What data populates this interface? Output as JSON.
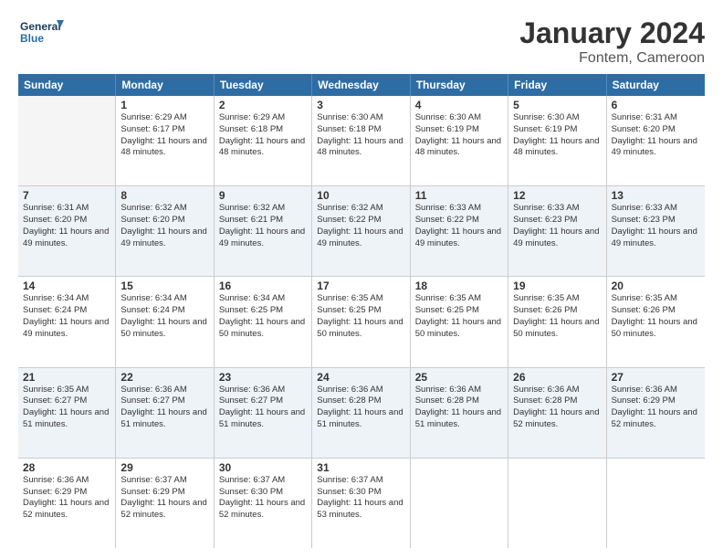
{
  "header": {
    "logo_line1": "General",
    "logo_line2": "Blue",
    "main_title": "January 2024",
    "subtitle": "Fontem, Cameroon"
  },
  "days_of_week": [
    "Sunday",
    "Monday",
    "Tuesday",
    "Wednesday",
    "Thursday",
    "Friday",
    "Saturday"
  ],
  "rows": [
    [
      {
        "day": "",
        "sunrise": "",
        "sunset": "",
        "daylight": "",
        "empty": true
      },
      {
        "day": "1",
        "sunrise": "Sunrise: 6:29 AM",
        "sunset": "Sunset: 6:17 PM",
        "daylight": "Daylight: 11 hours and 48 minutes."
      },
      {
        "day": "2",
        "sunrise": "Sunrise: 6:29 AM",
        "sunset": "Sunset: 6:18 PM",
        "daylight": "Daylight: 11 hours and 48 minutes."
      },
      {
        "day": "3",
        "sunrise": "Sunrise: 6:30 AM",
        "sunset": "Sunset: 6:18 PM",
        "daylight": "Daylight: 11 hours and 48 minutes."
      },
      {
        "day": "4",
        "sunrise": "Sunrise: 6:30 AM",
        "sunset": "Sunset: 6:19 PM",
        "daylight": "Daylight: 11 hours and 48 minutes."
      },
      {
        "day": "5",
        "sunrise": "Sunrise: 6:30 AM",
        "sunset": "Sunset: 6:19 PM",
        "daylight": "Daylight: 11 hours and 48 minutes."
      },
      {
        "day": "6",
        "sunrise": "Sunrise: 6:31 AM",
        "sunset": "Sunset: 6:20 PM",
        "daylight": "Daylight: 11 hours and 49 minutes."
      }
    ],
    [
      {
        "day": "7",
        "sunrise": "Sunrise: 6:31 AM",
        "sunset": "Sunset: 6:20 PM",
        "daylight": "Daylight: 11 hours and 49 minutes."
      },
      {
        "day": "8",
        "sunrise": "Sunrise: 6:32 AM",
        "sunset": "Sunset: 6:20 PM",
        "daylight": "Daylight: 11 hours and 49 minutes."
      },
      {
        "day": "9",
        "sunrise": "Sunrise: 6:32 AM",
        "sunset": "Sunset: 6:21 PM",
        "daylight": "Daylight: 11 hours and 49 minutes."
      },
      {
        "day": "10",
        "sunrise": "Sunrise: 6:32 AM",
        "sunset": "Sunset: 6:22 PM",
        "daylight": "Daylight: 11 hours and 49 minutes."
      },
      {
        "day": "11",
        "sunrise": "Sunrise: 6:33 AM",
        "sunset": "Sunset: 6:22 PM",
        "daylight": "Daylight: 11 hours and 49 minutes."
      },
      {
        "day": "12",
        "sunrise": "Sunrise: 6:33 AM",
        "sunset": "Sunset: 6:23 PM",
        "daylight": "Daylight: 11 hours and 49 minutes."
      },
      {
        "day": "13",
        "sunrise": "Sunrise: 6:33 AM",
        "sunset": "Sunset: 6:23 PM",
        "daylight": "Daylight: 11 hours and 49 minutes."
      }
    ],
    [
      {
        "day": "14",
        "sunrise": "Sunrise: 6:34 AM",
        "sunset": "Sunset: 6:24 PM",
        "daylight": "Daylight: 11 hours and 49 minutes."
      },
      {
        "day": "15",
        "sunrise": "Sunrise: 6:34 AM",
        "sunset": "Sunset: 6:24 PM",
        "daylight": "Daylight: 11 hours and 50 minutes."
      },
      {
        "day": "16",
        "sunrise": "Sunrise: 6:34 AM",
        "sunset": "Sunset: 6:25 PM",
        "daylight": "Daylight: 11 hours and 50 minutes."
      },
      {
        "day": "17",
        "sunrise": "Sunrise: 6:35 AM",
        "sunset": "Sunset: 6:25 PM",
        "daylight": "Daylight: 11 hours and 50 minutes."
      },
      {
        "day": "18",
        "sunrise": "Sunrise: 6:35 AM",
        "sunset": "Sunset: 6:25 PM",
        "daylight": "Daylight: 11 hours and 50 minutes."
      },
      {
        "day": "19",
        "sunrise": "Sunrise: 6:35 AM",
        "sunset": "Sunset: 6:26 PM",
        "daylight": "Daylight: 11 hours and 50 minutes."
      },
      {
        "day": "20",
        "sunrise": "Sunrise: 6:35 AM",
        "sunset": "Sunset: 6:26 PM",
        "daylight": "Daylight: 11 hours and 50 minutes."
      }
    ],
    [
      {
        "day": "21",
        "sunrise": "Sunrise: 6:35 AM",
        "sunset": "Sunset: 6:27 PM",
        "daylight": "Daylight: 11 hours and 51 minutes."
      },
      {
        "day": "22",
        "sunrise": "Sunrise: 6:36 AM",
        "sunset": "Sunset: 6:27 PM",
        "daylight": "Daylight: 11 hours and 51 minutes."
      },
      {
        "day": "23",
        "sunrise": "Sunrise: 6:36 AM",
        "sunset": "Sunset: 6:27 PM",
        "daylight": "Daylight: 11 hours and 51 minutes."
      },
      {
        "day": "24",
        "sunrise": "Sunrise: 6:36 AM",
        "sunset": "Sunset: 6:28 PM",
        "daylight": "Daylight: 11 hours and 51 minutes."
      },
      {
        "day": "25",
        "sunrise": "Sunrise: 6:36 AM",
        "sunset": "Sunset: 6:28 PM",
        "daylight": "Daylight: 11 hours and 51 minutes."
      },
      {
        "day": "26",
        "sunrise": "Sunrise: 6:36 AM",
        "sunset": "Sunset: 6:28 PM",
        "daylight": "Daylight: 11 hours and 52 minutes."
      },
      {
        "day": "27",
        "sunrise": "Sunrise: 6:36 AM",
        "sunset": "Sunset: 6:29 PM",
        "daylight": "Daylight: 11 hours and 52 minutes."
      }
    ],
    [
      {
        "day": "28",
        "sunrise": "Sunrise: 6:36 AM",
        "sunset": "Sunset: 6:29 PM",
        "daylight": "Daylight: 11 hours and 52 minutes."
      },
      {
        "day": "29",
        "sunrise": "Sunrise: 6:37 AM",
        "sunset": "Sunset: 6:29 PM",
        "daylight": "Daylight: 11 hours and 52 minutes."
      },
      {
        "day": "30",
        "sunrise": "Sunrise: 6:37 AM",
        "sunset": "Sunset: 6:30 PM",
        "daylight": "Daylight: 11 hours and 52 minutes."
      },
      {
        "day": "31",
        "sunrise": "Sunrise: 6:37 AM",
        "sunset": "Sunset: 6:30 PM",
        "daylight": "Daylight: 11 hours and 53 minutes."
      },
      {
        "day": "",
        "sunrise": "",
        "sunset": "",
        "daylight": "",
        "empty": true
      },
      {
        "day": "",
        "sunrise": "",
        "sunset": "",
        "daylight": "",
        "empty": true
      },
      {
        "day": "",
        "sunrise": "",
        "sunset": "",
        "daylight": "",
        "empty": true
      }
    ]
  ]
}
